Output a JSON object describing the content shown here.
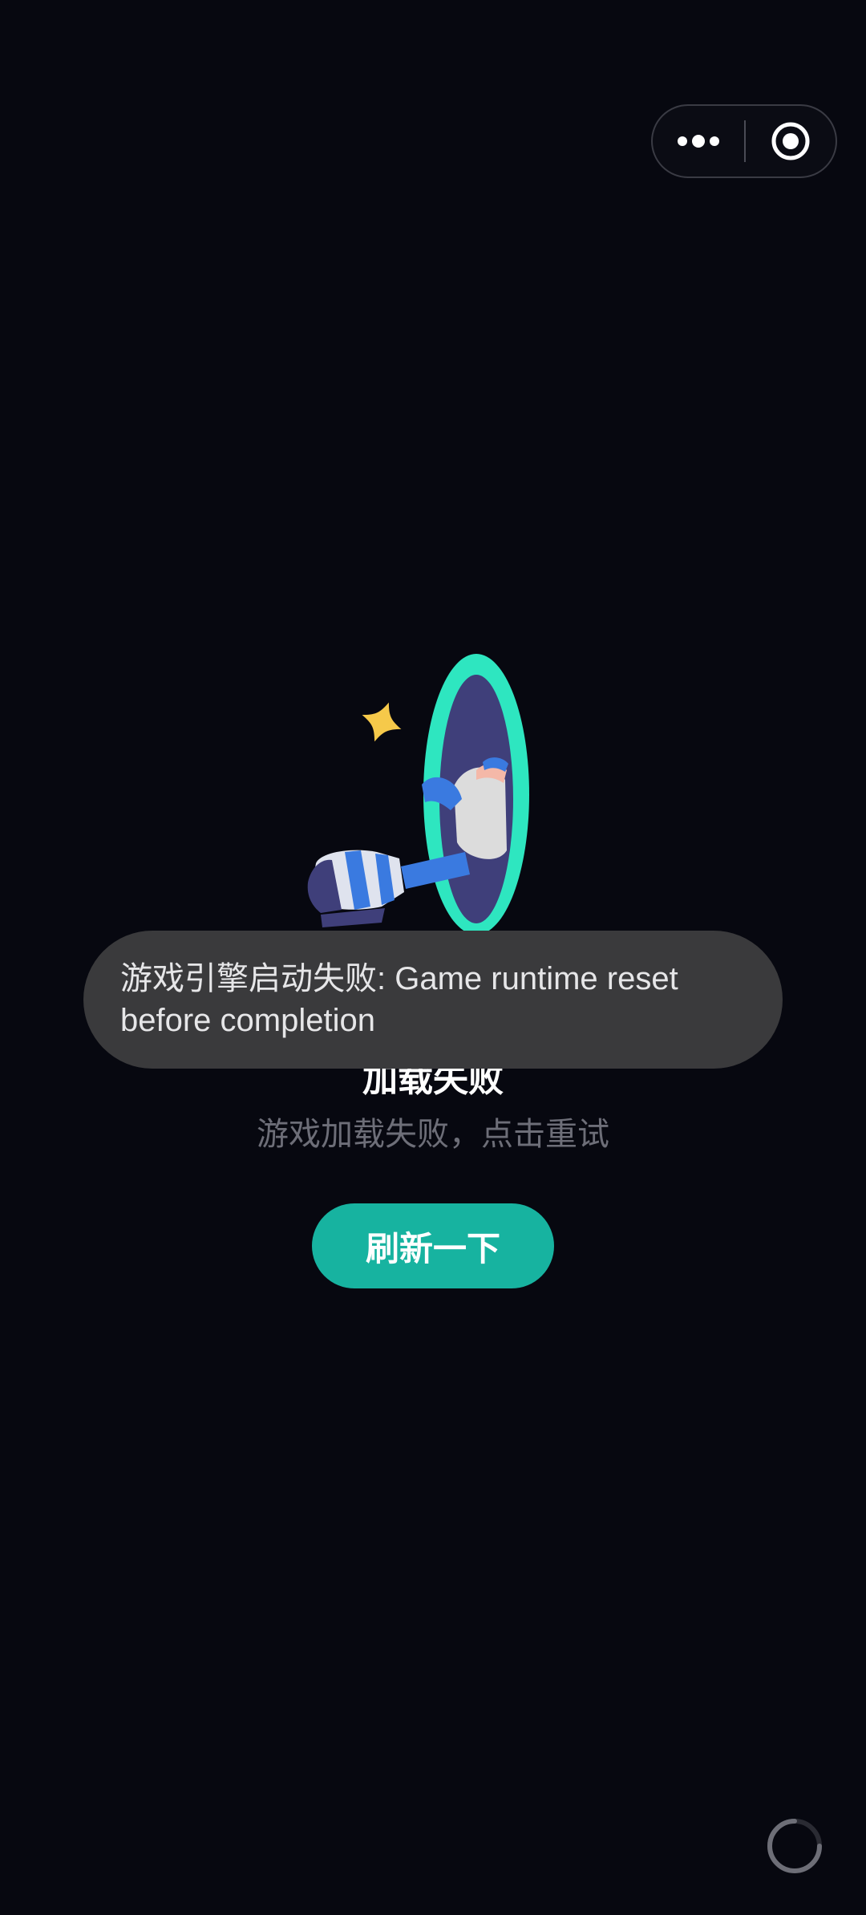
{
  "capsule": {
    "more_icon": "more-dots-icon",
    "close_icon": "target-close-icon"
  },
  "illustration": {
    "name": "portal-character-illustration",
    "colors": {
      "portal": "#2ee6c0",
      "portal_inner": "#3f3f7a",
      "star": "#f6c94a",
      "boot": "#3a7ae0"
    }
  },
  "error": {
    "title": "加载失败",
    "subtitle": "游戏加载失败，点击重试"
  },
  "refresh_button": {
    "label": "刷新一下",
    "color": "#17b3a0"
  },
  "toast": {
    "message": "游戏引擎启动失败: Game runtime reset before completion"
  },
  "spinner": {
    "icon": "loading-spinner-icon"
  }
}
